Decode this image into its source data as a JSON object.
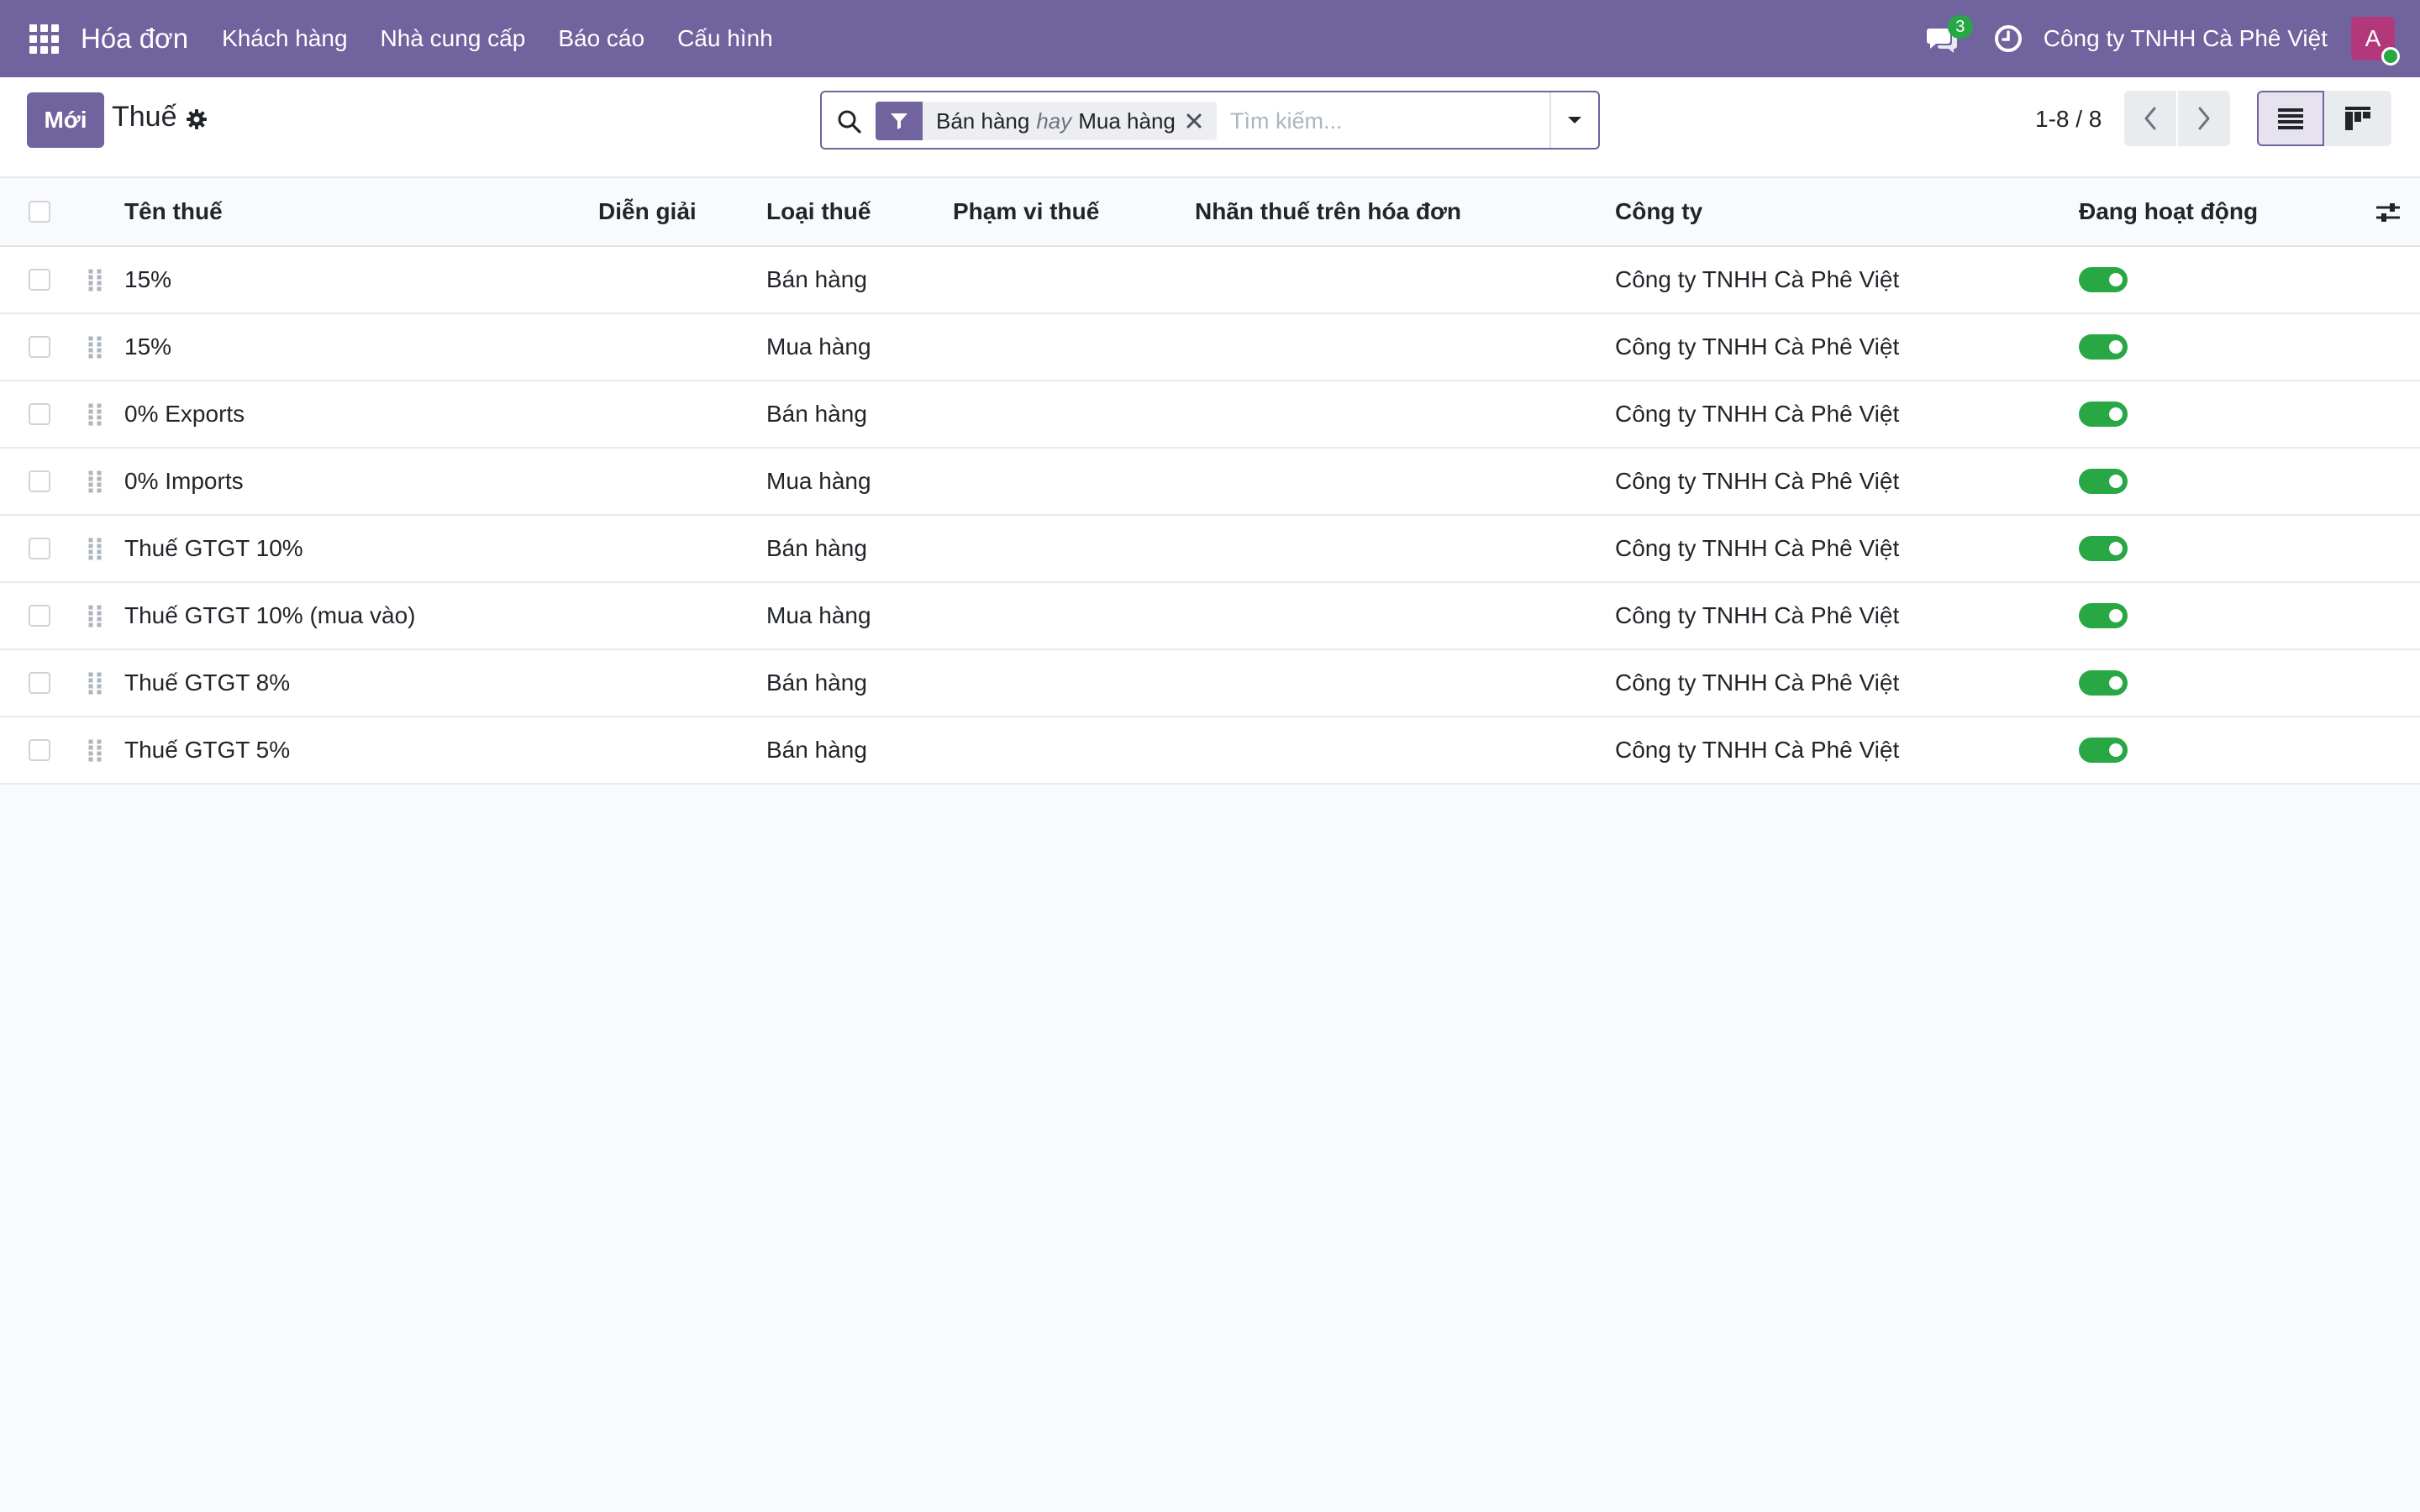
{
  "navbar": {
    "app_name": "Hóa đơn",
    "menu": [
      "Khách hàng",
      "Nhà cung cấp",
      "Báo cáo",
      "Cấu hình"
    ],
    "messages_count": "3",
    "company": "Công ty TNHH Cà Phê Việt",
    "avatar_initial": "A"
  },
  "control_panel": {
    "new_button": "Mới",
    "title": "Thuế",
    "search": {
      "facet_values": [
        "Bán hàng",
        "Mua hàng"
      ],
      "facet_separator": "hay",
      "placeholder": "Tìm kiếm..."
    },
    "pager": "1-8 / 8"
  },
  "table": {
    "columns": [
      "Tên thuế",
      "Diễn giải",
      "Loại thuế",
      "Phạm vi thuế",
      "Nhãn thuế trên hóa đơn",
      "Công ty",
      "Đang hoạt động"
    ],
    "rows": [
      {
        "name": "15%",
        "description": "",
        "type": "Bán hàng",
        "scope": "",
        "label": "",
        "company": "Công ty TNHH Cà Phê Việt",
        "active": true
      },
      {
        "name": "15%",
        "description": "",
        "type": "Mua hàng",
        "scope": "",
        "label": "",
        "company": "Công ty TNHH Cà Phê Việt",
        "active": true
      },
      {
        "name": "0% Exports",
        "description": "",
        "type": "Bán hàng",
        "scope": "",
        "label": "",
        "company": "Công ty TNHH Cà Phê Việt",
        "active": true
      },
      {
        "name": "0% Imports",
        "description": "",
        "type": "Mua hàng",
        "scope": "",
        "label": "",
        "company": "Công ty TNHH Cà Phê Việt",
        "active": true
      },
      {
        "name": "Thuế GTGT 10%",
        "description": "",
        "type": "Bán hàng",
        "scope": "",
        "label": "",
        "company": "Công ty TNHH Cà Phê Việt",
        "active": true
      },
      {
        "name": "Thuế GTGT 10% (mua vào)",
        "description": "",
        "type": "Mua hàng",
        "scope": "",
        "label": "",
        "company": "Công ty TNHH Cà Phê Việt",
        "active": true
      },
      {
        "name": "Thuế GTGT 8%",
        "description": "",
        "type": "Bán hàng",
        "scope": "",
        "label": "",
        "company": "Công ty TNHH Cà Phê Việt",
        "active": true
      },
      {
        "name": "Thuế GTGT 5%",
        "description": "",
        "type": "Bán hàng",
        "scope": "",
        "label": "",
        "company": "Công ty TNHH Cà Phê Việt",
        "active": true
      }
    ]
  },
  "colors": {
    "brand": "#71639e",
    "active_toggle": "#28a745",
    "badge": "#28a745",
    "avatar": "#b2387b"
  },
  "icons": [
    "apps-grid-icon",
    "chat-icon",
    "clock-icon",
    "gear-icon",
    "search-icon",
    "filter-icon",
    "close-icon",
    "caret-down-icon",
    "chevron-left-icon",
    "chevron-right-icon",
    "list-view-icon",
    "kanban-view-icon",
    "drag-handle-icon",
    "optional-columns-icon"
  ]
}
